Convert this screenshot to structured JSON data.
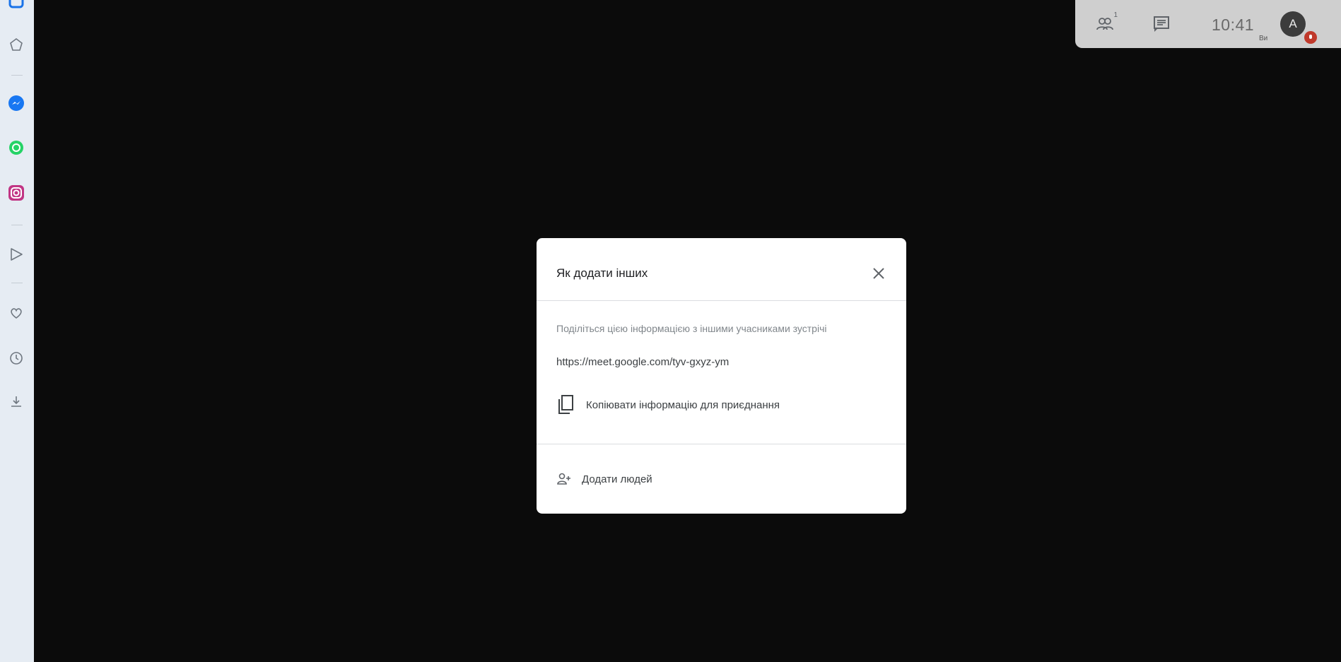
{
  "sidebar": {
    "items": [
      {
        "icon": "app-logo-icon",
        "color": "#1a73e8"
      },
      {
        "icon": "home-icon"
      },
      {
        "icon": "messenger-icon",
        "color": "#1877f2"
      },
      {
        "icon": "whatsapp-icon",
        "color": "#25d366"
      },
      {
        "icon": "instagram-icon",
        "color": "#c13584"
      },
      {
        "icon": "send-icon"
      },
      {
        "icon": "heart-icon"
      },
      {
        "icon": "history-icon"
      },
      {
        "icon": "download-icon"
      }
    ]
  },
  "topbar": {
    "participants_icon": "people-icon",
    "participants_count": "1",
    "chat_icon": "chat-icon",
    "time": "10:41",
    "you_label": "Ви",
    "avatar_letter": "A",
    "badge_color": "#c0392b"
  },
  "dialog": {
    "title": "Як додати інших",
    "description": "Поділіться цією інформацією з іншими учасниками зустрічі",
    "link": "https://meet.google.com/tyv-gxyz-ym",
    "copy_label": "Копіювати інформацію для приєднання",
    "add_label": "Додати людей"
  }
}
